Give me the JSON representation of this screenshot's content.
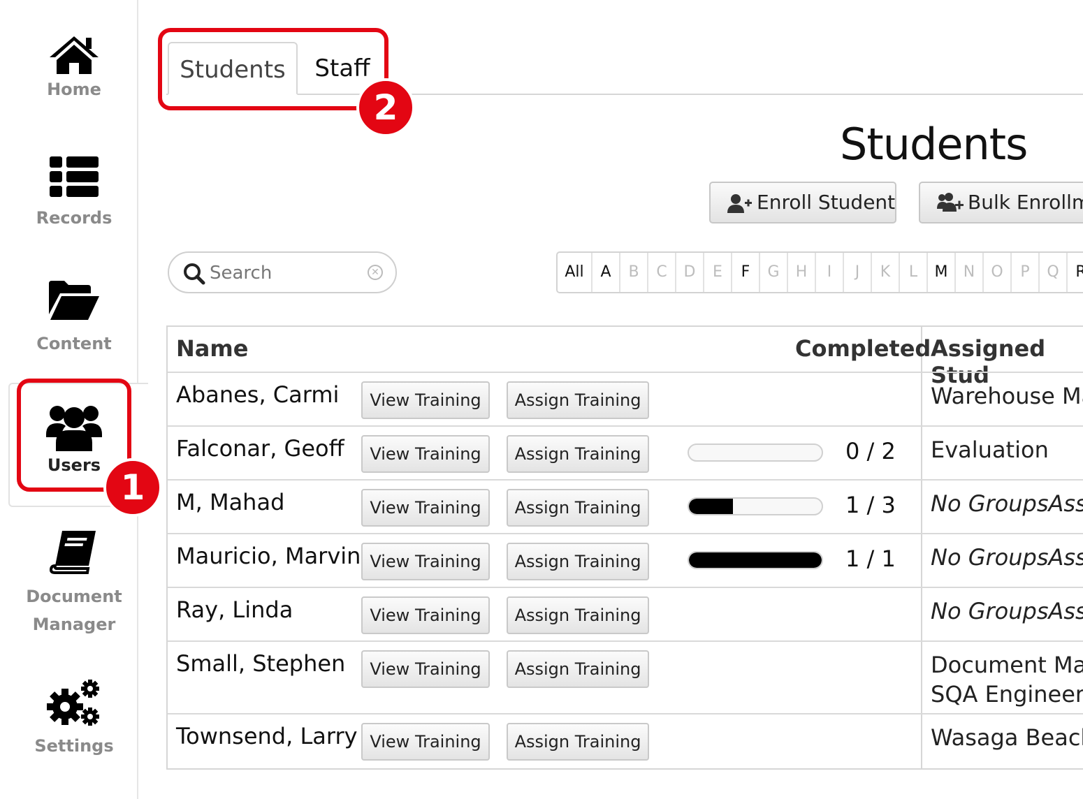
{
  "sidebar": {
    "items": [
      {
        "label": "Home",
        "icon": "home-icon"
      },
      {
        "label": "Records",
        "icon": "list-icon"
      },
      {
        "label": "Content",
        "icon": "folder-open-icon"
      },
      {
        "label": "Users",
        "icon": "users-icon",
        "active": true
      },
      {
        "label": "Document Manager",
        "icon": "book-icon"
      },
      {
        "label": "Settings",
        "icon": "gears-icon"
      }
    ]
  },
  "callouts": {
    "one": "1",
    "two": "2",
    "color": "#e30613"
  },
  "tabs": [
    {
      "label": "Students",
      "active": true
    },
    {
      "label": "Staff"
    }
  ],
  "page_title": "Students",
  "actions": {
    "enroll": "Enroll Student",
    "bulk": "Bulk Enrollm"
  },
  "search": {
    "placeholder": "Search",
    "value": ""
  },
  "alphabet": {
    "letters": [
      "All",
      "A",
      "B",
      "C",
      "D",
      "E",
      "F",
      "G",
      "H",
      "I",
      "J",
      "K",
      "L",
      "M",
      "N",
      "O",
      "P",
      "Q",
      "R"
    ],
    "enabled": [
      "All",
      "A",
      "F",
      "M",
      "R"
    ]
  },
  "table": {
    "headers": {
      "name": "Name",
      "completed": "Completed",
      "assigned": "Assigned Stud"
    },
    "view_label": "View Training",
    "assign_label": "Assign Training",
    "rows": [
      {
        "name": "Abanes, Carmi",
        "completed": null,
        "total": null,
        "count": "",
        "assigned": [
          "Warehouse Ma"
        ],
        "italic": false
      },
      {
        "name": "Falconar, Geoff",
        "completed": 0,
        "total": 2,
        "count": "0 / 2",
        "assigned": [
          "Evaluation"
        ],
        "italic": false
      },
      {
        "name": "M, Mahad",
        "completed": 1,
        "total": 3,
        "count": "1 / 3",
        "assigned": [
          "No GroupsAssig"
        ],
        "italic": true
      },
      {
        "name": "Mauricio, Marvin",
        "completed": 1,
        "total": 1,
        "count": "1 / 1",
        "assigned": [
          "No GroupsAssig"
        ],
        "italic": true
      },
      {
        "name": "Ray, Linda",
        "completed": null,
        "total": null,
        "count": "",
        "assigned": [
          "No GroupsAssig"
        ],
        "italic": true
      },
      {
        "name": "Small, Stephen",
        "completed": null,
        "total": null,
        "count": "",
        "assigned": [
          "Document Mar",
          "SQA Engineer"
        ],
        "italic": false
      },
      {
        "name": "Townsend, Larry",
        "completed": null,
        "total": null,
        "count": "",
        "assigned": [
          "Wasaga Beach"
        ],
        "italic": false
      }
    ]
  }
}
